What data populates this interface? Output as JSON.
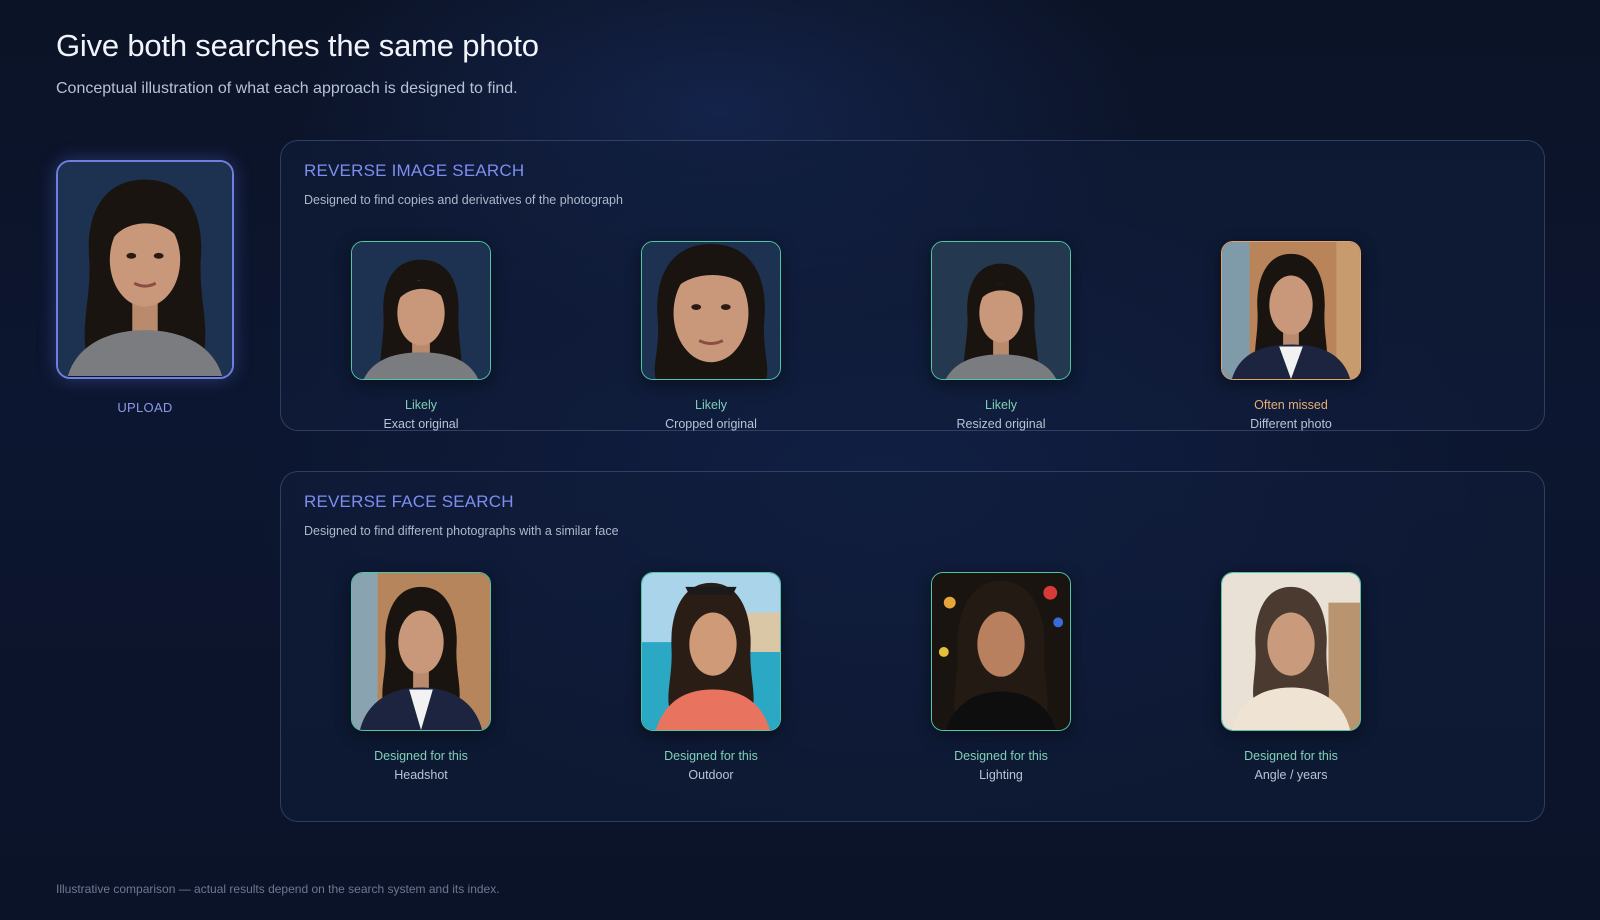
{
  "header": {
    "title": "Give both searches the same photo",
    "subtitle": "Conceptual illustration of what each approach is designed to find."
  },
  "upload": {
    "label": "UPLOAD"
  },
  "image_search": {
    "title": "REVERSE IMAGE SEARCH",
    "description": "Designed to find copies and derivatives of the photograph",
    "cards": [
      {
        "status": "Likely",
        "caption": "Exact original"
      },
      {
        "status": "Likely",
        "caption": "Cropped original"
      },
      {
        "status": "Likely",
        "caption": "Resized original"
      },
      {
        "status": "Often missed",
        "caption": "Different photo"
      }
    ]
  },
  "face_search": {
    "title": "REVERSE FACE SEARCH",
    "description": "Designed to find different photographs with a similar face",
    "cards": [
      {
        "status": "Designed for this",
        "caption": "Headshot"
      },
      {
        "status": "Designed for this",
        "caption": "Outdoor"
      },
      {
        "status": "Designed for this",
        "caption": "Lighting"
      },
      {
        "status": "Designed for this",
        "caption": "Angle / years"
      }
    ]
  },
  "footer": {
    "note": "Illustrative comparison — actual results depend on the search system and its index."
  },
  "colors": {
    "accent": "#7d8ef0",
    "match": "#4fc6a6",
    "missed": "#e0a46c",
    "background": "#0c1630"
  }
}
